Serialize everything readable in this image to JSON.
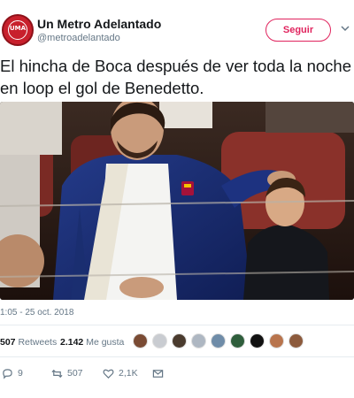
{
  "account": {
    "name": "Un Metro Adelantado",
    "handle": "@metroadelantado",
    "avatar_text": "UMA",
    "follow_label": "Seguir"
  },
  "tweet": {
    "text": "El hincha de Boca después de ver toda la noche en loop el gol de Benedetto.",
    "timestamp": "1:05 - 25 oct. 2018"
  },
  "stats": {
    "retweets_value": "507",
    "retweets_label": "Retweets",
    "likes_value": "2.142",
    "likes_label": "Me gusta"
  },
  "likers_count": 9,
  "actions": {
    "replies": "9",
    "retweets": "507",
    "likes": "2,1K"
  },
  "colors": {
    "accent": "#e0245e",
    "muted": "#657786",
    "text": "#14171a",
    "divider": "#e6ecf0",
    "avatar_bg": "#c8202c"
  },
  "icons": [
    "chevron-down-icon",
    "reply-icon",
    "retweet-icon",
    "heart-icon",
    "message-icon"
  ]
}
